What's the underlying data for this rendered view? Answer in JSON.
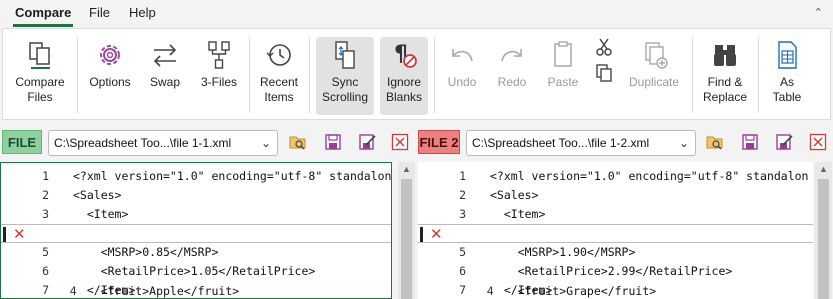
{
  "menu": {
    "compare": "Compare",
    "file": "File",
    "help": "Help"
  },
  "ribbon": {
    "compare_files": [
      "Compare",
      "Files"
    ],
    "options": "Options",
    "swap": "Swap",
    "three_files": "3-Files",
    "recent_items": [
      "Recent",
      "Items"
    ],
    "sync_scrolling": [
      "Sync",
      "Scrolling"
    ],
    "ignore_blanks": [
      "Ignore",
      "Blanks"
    ],
    "undo": "Undo",
    "redo": "Redo",
    "paste": "Paste",
    "duplicate": "Duplicate",
    "find_replace": [
      "Find &",
      "Replace"
    ],
    "as_table": [
      "As",
      "Table"
    ]
  },
  "file1": {
    "badge": "FILE 1",
    "path": "C:\\Spreadsheet Too...\\file 1-1.xml"
  },
  "file2": {
    "badge": "FILE 2",
    "path": "C:\\Spreadsheet Too...\\file 1-2.xml"
  },
  "left_lines": [
    {
      "n": "1",
      "text": "<?xml version=\"1.0\" encoding=\"utf-8\" standalon"
    },
    {
      "n": "2",
      "text": "<Sales>"
    },
    {
      "n": "3",
      "text": "  <Item>"
    },
    {
      "n": "4",
      "text": "    <fruit>Apple</fruit>"
    },
    {
      "n": "5",
      "text": "    <MSRP>0.85</MSRP>"
    },
    {
      "n": "6",
      "text": "    <RetailPrice>1.05</RetailPrice>"
    },
    {
      "n": "7",
      "text": "  </Item>"
    }
  ],
  "right_lines": [
    {
      "n": "1",
      "text": "<?xml version=\"1.0\" encoding=\"utf-8\" standalon"
    },
    {
      "n": "2",
      "text": "<Sales>"
    },
    {
      "n": "3",
      "text": "  <Item>"
    },
    {
      "n": "4",
      "text": "    <fruit>Grape</fruit>"
    },
    {
      "n": "5",
      "text": "    <MSRP>1.90</MSRP>"
    },
    {
      "n": "6",
      "text": "    <RetailPrice>2.99</RetailPrice>"
    },
    {
      "n": "7",
      "text": "  </Item>"
    }
  ],
  "colors": {
    "accent_green": "#1f7244",
    "file1_badge": "#8fd19e",
    "file2_badge": "#f08080",
    "diff_x": "#d03a3a"
  }
}
